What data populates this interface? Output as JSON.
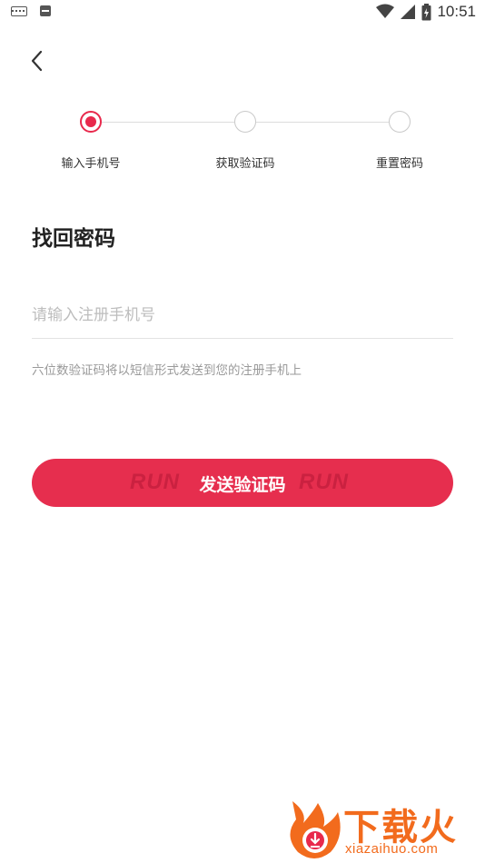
{
  "status_bar": {
    "time": "10:51",
    "icons": [
      "keyboard-icon",
      "message-icon",
      "wifi-icon",
      "signal-icon",
      "battery-icon"
    ]
  },
  "nav": {
    "back_icon": "chevron-left-icon"
  },
  "steps": [
    {
      "label": "输入手机号",
      "active": true
    },
    {
      "label": "获取验证码",
      "active": false
    },
    {
      "label": "重置密码",
      "active": false
    }
  ],
  "page": {
    "title": "找回密码"
  },
  "form": {
    "phone_placeholder": "请输入注册手机号",
    "phone_value": "",
    "hint": "六位数验证码将以短信形式发送到您的注册手机上"
  },
  "send_button": {
    "label": "发送验证码",
    "deco_text": "RUN"
  },
  "watermark": {
    "text": "下载火",
    "url": "xiazaihuo.com"
  },
  "colors": {
    "accent": "#e62e4e",
    "hint": "#9a9a9a",
    "watermark": "#f26b1d"
  }
}
